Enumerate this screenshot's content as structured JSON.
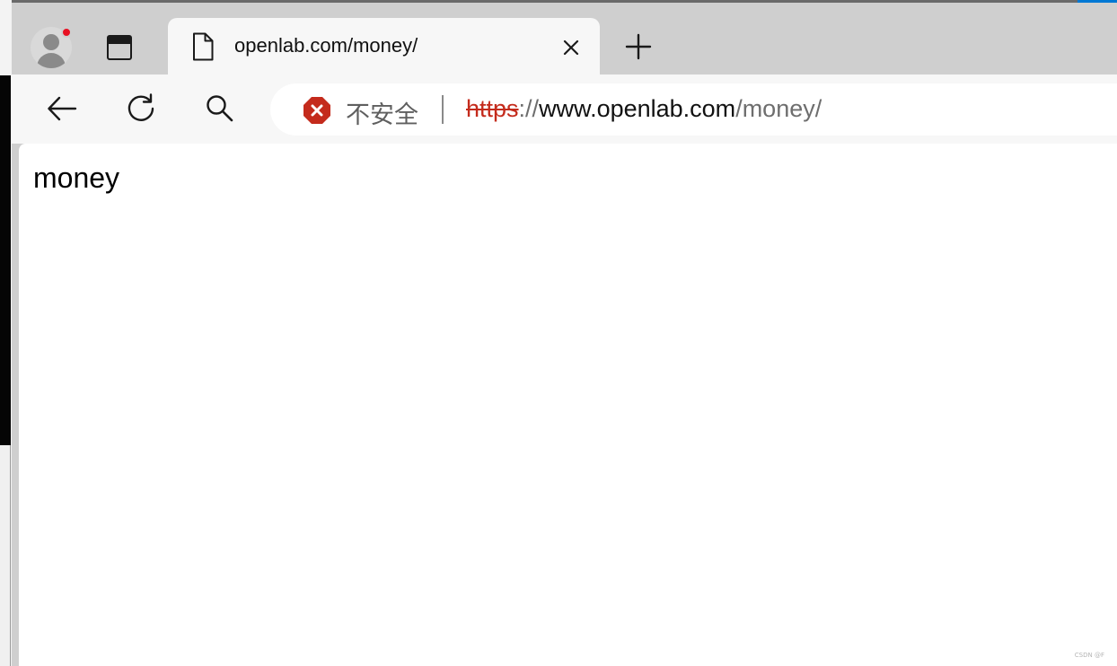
{
  "tab": {
    "title": "openlab.com/money/"
  },
  "addressbar": {
    "security_label": "不安全",
    "url_scheme": "https",
    "url_separator": "://",
    "url_host": "www.openlab.com",
    "url_path": "/money/"
  },
  "page": {
    "body_text": "money"
  },
  "watermark": "CSDN @F",
  "icons": {
    "profile": "avatar-icon",
    "tab_actions": "tab-actions-icon",
    "page": "page-icon",
    "close": "close-icon",
    "new_tab": "plus-icon",
    "back": "back-arrow-icon",
    "refresh": "refresh-icon",
    "search": "search-icon",
    "security": "security-warning-icon"
  },
  "colors": {
    "insecure_red": "#c42b1c",
    "tabstrip_bg": "#cfcfcf",
    "toolbar_bg": "#f7f7f7"
  }
}
